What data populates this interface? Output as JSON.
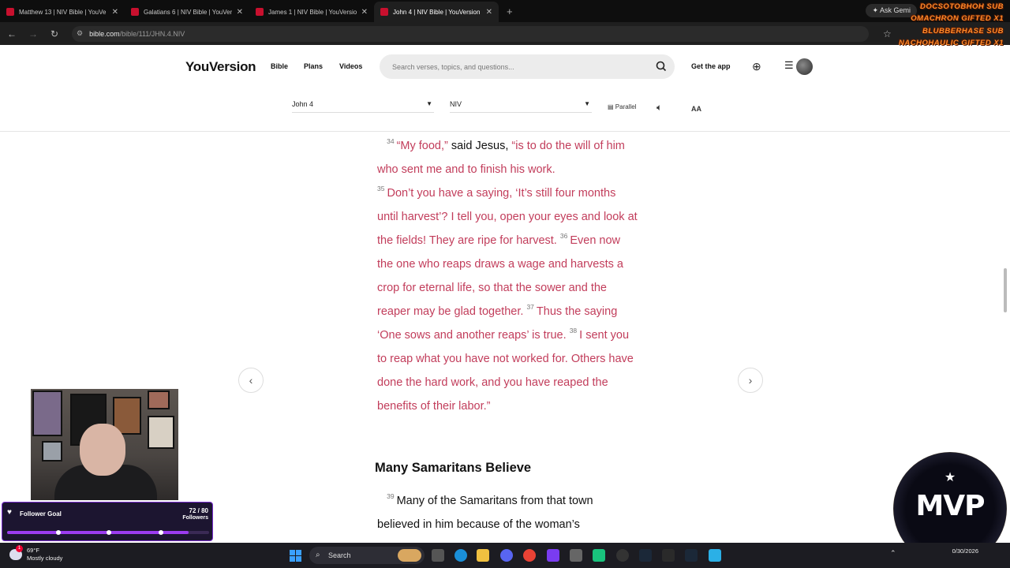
{
  "browser": {
    "tabs": [
      {
        "title": "Matthew 13 | NIV Bible | YouVe",
        "active": false
      },
      {
        "title": "Galatians 6 | NIV Bible | YouVer",
        "active": false
      },
      {
        "title": "James 1 | NIV Bible | YouVersion",
        "active": false
      },
      {
        "title": "John 4 | NIV Bible | YouVersion",
        "active": true
      }
    ],
    "new_tab": "+",
    "ask_gemini": "Ask Gemi",
    "url_host": "bible.com",
    "url_path": "/bible/111/JHN.4.NIV"
  },
  "header": {
    "logo": "YouVersion",
    "nav": [
      "Bible",
      "Plans",
      "Videos"
    ],
    "search_placeholder": "Search verses, topics, and questions...",
    "get_app": "Get the app"
  },
  "controls": {
    "book": "John 4",
    "version": "NIV",
    "parallel": "Parallel",
    "font_size": "AA"
  },
  "reader": {
    "v34_num": "34",
    "v34_a": "“My food,”",
    "v34_b": " said Jesus, ",
    "v34_c": "“is to do the will of him who sent me and to finish his work.",
    "v35_num": "35",
    "v35": "Don’t you have a saying, ‘It’s still four months until harvest’? I tell you, open your eyes and look at the fields! They are ripe for harvest.",
    "v36_num": "36",
    "v36": "Even now the one who reaps draws a wage and harvests a crop for eternal life, so that the sower and the reaper may be glad together.",
    "v37_num": "37",
    "v37": "Thus the saying ‘One sows and another reaps’ is true.",
    "v38_num": "38",
    "v38": "I sent you to reap what you have not worked for. Others have done the hard work, and you have reaped the benefits of their labor.”",
    "heading": "Many Samaritans Believe",
    "v39_num": "39",
    "v39": "Many of the Samaritans from that town believed in him because of the woman’s"
  },
  "stream": {
    "goal_title": "Follower Goal",
    "goal_count": "72 / 80",
    "goal_label": "Followers",
    "goal_progress": 0.9,
    "alerts": [
      "DOCSOTOBHOH SUB",
      "OMACHRON GIFTED X1",
      "BLUBBERHASE SUB",
      "NACHOHAULIC GIFTED X1"
    ],
    "badge": "MVP"
  },
  "taskbar": {
    "temp": "69°F",
    "condition": "Mostly cloudy",
    "search": "Search",
    "date": "0/30/2026"
  }
}
